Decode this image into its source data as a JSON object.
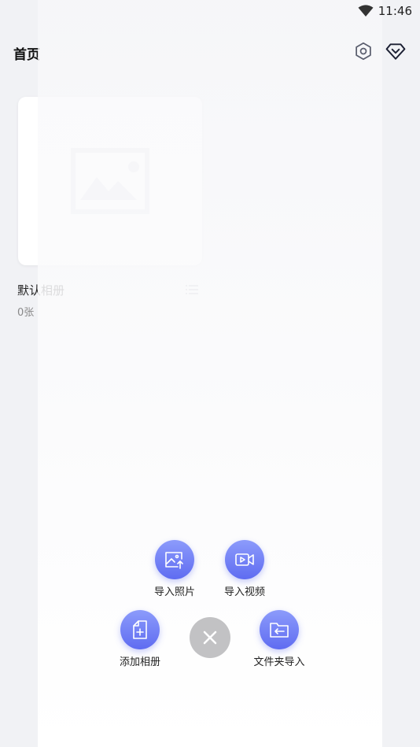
{
  "status_bar": {
    "time": "11:46",
    "wifi_icon": "wifi-icon"
  },
  "header": {
    "title": "首页",
    "settings_icon": "gear-icon",
    "vip_icon": "diamond-icon"
  },
  "album": {
    "name": "默认相册",
    "count": "0张",
    "placeholder_icon": "image-placeholder-icon",
    "menu_icon": "list-icon"
  },
  "actions": {
    "import_photo": "导入照片",
    "import_video": "导入视频",
    "add_album": "添加相册",
    "folder_import": "文件夹导入",
    "close_icon": "close-icon"
  },
  "colors": {
    "accent_top": "#8c9bfb",
    "accent_bottom": "#5f6cf1",
    "close_button": "#c2c2c4"
  }
}
